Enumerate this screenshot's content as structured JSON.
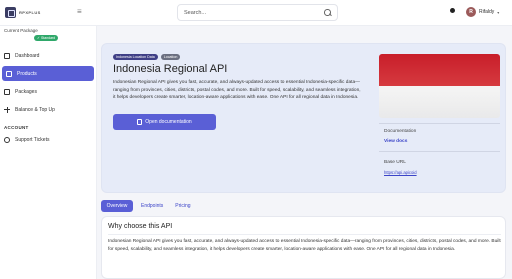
{
  "header": {
    "logo_text": "RPXPLUS",
    "search_placeholder": "Search...",
    "user": {
      "initial": "R",
      "name": "Rifaldy"
    }
  },
  "sidebar": {
    "package_label": "Current Package",
    "package_badge": "Standard",
    "items": [
      {
        "label": "Dashboard",
        "icon": "grid-icon",
        "active": false
      },
      {
        "label": "Products",
        "icon": "box-icon",
        "active": true
      },
      {
        "label": "Packages",
        "icon": "package-icon",
        "active": false
      },
      {
        "label": "Balance & Top Up",
        "icon": "plus-icon",
        "active": false
      }
    ],
    "account_section": "ACCOUNT",
    "account_items": [
      {
        "label": "Support Tickets",
        "icon": "support-icon"
      }
    ]
  },
  "hero": {
    "tags": [
      "Indonesia Location Data",
      "Location"
    ],
    "title": "Indonesia Regional API",
    "description": "Indonesian Regional API gives you fast, accurate, and always-updated access to essential Indonesia-specific data—ranging from provinces, cities, districts, postal codes, and more. Built for speed, scalability, and seamless integration, it helps developers create smarter, location-aware applications with ease. One API for all regional data in Indonesia.",
    "doc_button": "Open documentation",
    "documentation_label": "Documentation",
    "view_docs": "View docs",
    "base_url_label": "Base URL",
    "base_url": "https://api.apicoid"
  },
  "tabs": [
    {
      "label": "Overview",
      "active": true
    },
    {
      "label": "Endpoints",
      "active": false
    },
    {
      "label": "Pricing",
      "active": false
    }
  ],
  "why": {
    "title": "Why choose this API",
    "text": "Indonesian Regional API gives you fast, accurate, and always-updated access to essential Indonesia-specific data—ranging from provinces, cities, districts, postal codes, and more. Built for speed, scalability, and seamless integration, it helps developers create smarter, location-aware applications with ease. One API for all regional data in Indonesia."
  },
  "colors": {
    "accent": "#5a5fd6",
    "badge_green": "#2fa86a",
    "link": "#3b44c8",
    "flag_red": "#c81e2a"
  }
}
